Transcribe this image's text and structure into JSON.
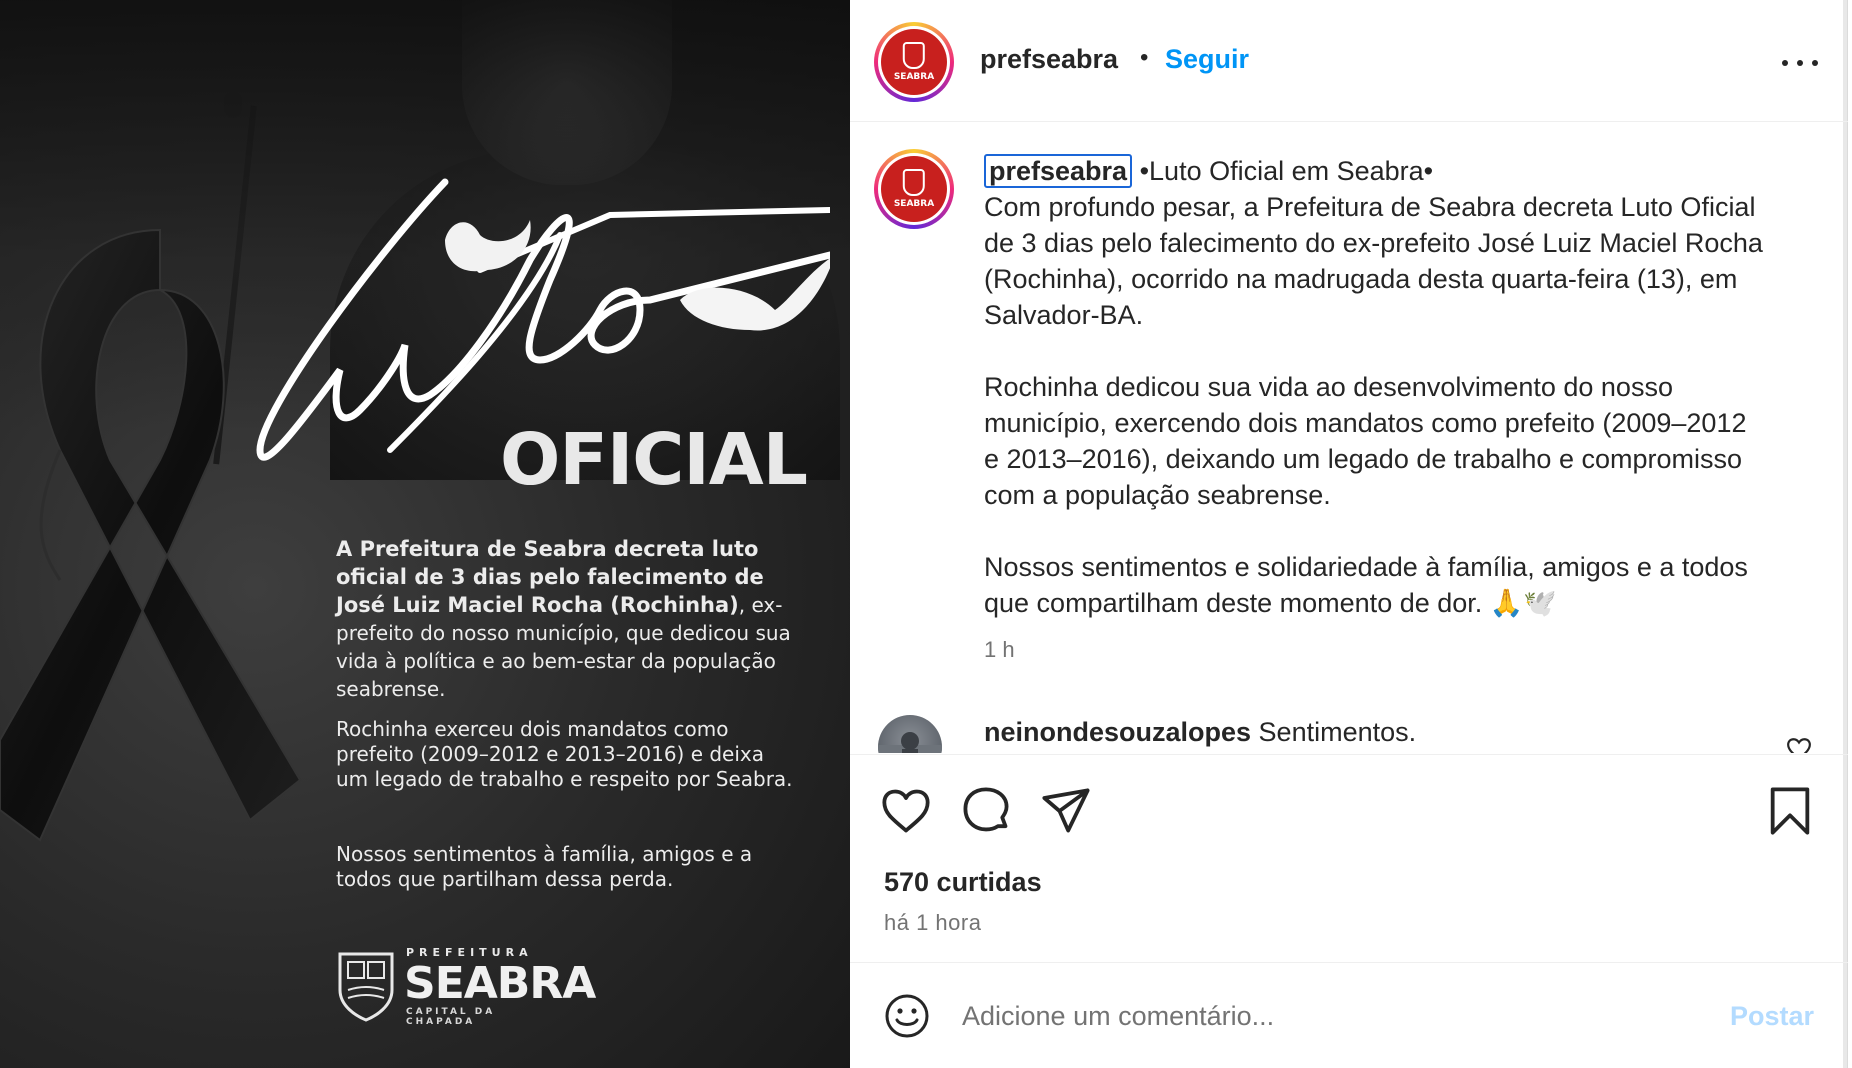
{
  "image": {
    "script_word": "luto",
    "oficial_word": "OFICIAL",
    "para1_bold": "A Prefeitura de Seabra decreta luto oficial de 3 dias pelo falecimento de José Luiz Maciel Rocha (Rochinha)",
    "para1_rest": ", ex-prefeito do nosso município, que dedicou sua vida à política e ao bem-estar da população seabrense.",
    "para2": "Rochinha exerceu dois mandatos como prefeito (2009–2012 e 2013–2016) e deixa um legado de trabalho e respeito por Seabra.",
    "para3": "Nossos sentimentos à família, amigos e a todos que partilham dessa perda.",
    "logo_prefeitura": "PREFEITURA",
    "logo_name": "SEABRA",
    "logo_caption": "CAPITAL DA CHAPADA"
  },
  "avatar_label": "SEABRA",
  "header": {
    "username": "prefseabra",
    "separator": "•",
    "follow_label": "Seguir"
  },
  "caption": {
    "username": "prefseabra",
    "title": " •Luto Oficial em Seabra•",
    "para1": "Com profundo pesar, a Prefeitura de Seabra decreta Luto Oficial de 3 dias pelo falecimento do ex-prefeito José Luiz Maciel Rocha (Rochinha), ocorrido na madrugada desta quarta-feira (13), em Salvador-BA.",
    "para2": "Rochinha dedicou sua vida ao desenvolvimento do nosso município, exercendo dois mandatos como prefeito (2009–2012 e 2013–2016), deixando um legado de trabalho e compromisso com a população seabrense.",
    "para3": "Nossos sentimentos e solidariedade à família, amigos e a todos que compartilham deste momento de dor. 🙏🕊️",
    "time": "1 h"
  },
  "comment": {
    "username": "neinondesouzalopes",
    "text": " Sentimentos."
  },
  "actions": {
    "likes": "570 curtidas",
    "posted_ago": "há 1 hora"
  },
  "comment_bar": {
    "placeholder": "Adicione um comentário...",
    "post_label": "Postar"
  },
  "colors": {
    "accent": "#0095f6",
    "brand_red": "#c8201e",
    "post_disabled": "#b3dbff"
  },
  "icons": [
    "heart-icon",
    "comment-icon",
    "share-icon",
    "bookmark-icon",
    "more-icon",
    "emoji-icon",
    "comment-like-icon"
  ]
}
